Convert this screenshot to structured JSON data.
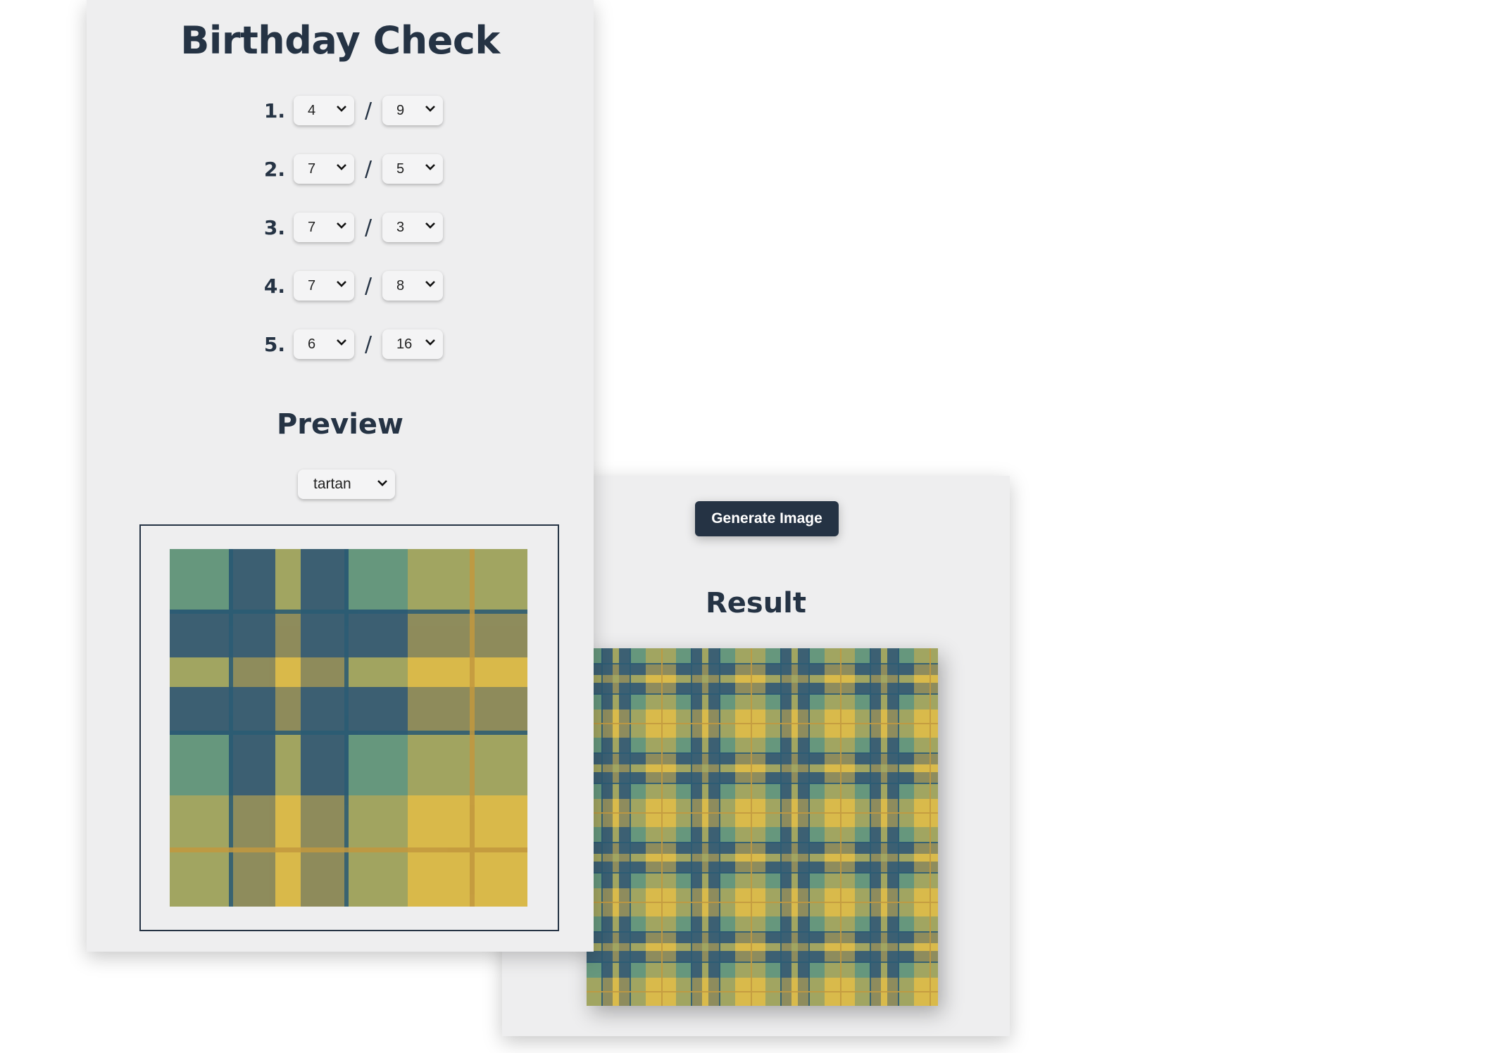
{
  "app": {
    "title": "Birthday Check"
  },
  "dates": [
    {
      "index": "1.",
      "month": "4",
      "day": "9"
    },
    {
      "index": "2.",
      "month": "7",
      "day": "5"
    },
    {
      "index": "3.",
      "month": "7",
      "day": "3"
    },
    {
      "index": "4.",
      "month": "7",
      "day": "8"
    },
    {
      "index": "5.",
      "month": "6",
      "day": "16"
    }
  ],
  "separator": "/",
  "preview": {
    "title": "Preview",
    "style_value": "tartan"
  },
  "result": {
    "title": "Result",
    "generate_label": "Generate Image"
  },
  "icons": {
    "dropdown": "chevron-down-icon"
  },
  "colors": {
    "text": "#253344",
    "button_bg": "#253344",
    "panel_bg": "#eeeeef",
    "tartan_base": [
      "#66977d",
      "#466a77",
      "#96a66b",
      "#4a6e7a",
      "#f8c346"
    ],
    "tartan_line_blue": "#2a5c74",
    "tartan_line_gold": "#c2983e"
  }
}
